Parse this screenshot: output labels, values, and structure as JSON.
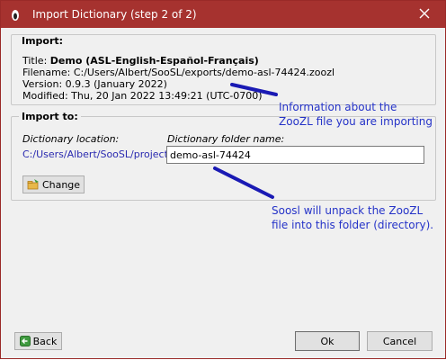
{
  "window": {
    "title": "Import Dictionary (step 2 of 2)"
  },
  "import_group": {
    "heading": "Import:",
    "title_label": "Title:",
    "title_value": "Demo (ASL-English-Español-Français)",
    "filename_label": "Filename:",
    "filename_value": "C:/Users/Albert/SooSL/exports/demo-asl-74424.zoozl",
    "version_label": "Version:",
    "version_value": "0.9.3 (January 2022)",
    "modified_label": "Modified:",
    "modified_value": "Thu, 20 Jan 2022 13:49:21 (UTC-0700)"
  },
  "import_to_group": {
    "heading": "Import to:",
    "location_label": "Dictionary location:",
    "location_value": "C:/Users/Albert/SooSL/projects/",
    "folder_label": "Dictionary folder name:",
    "folder_value": "demo-asl-74424",
    "change_button": "Change",
    "change_icon": "folder-change-icon"
  },
  "annotations": {
    "note1_line1": "Information about the",
    "note1_line2": "ZooZL file you are importing",
    "note2_line1": "Soosl will unpack the ZooZL",
    "note2_line2": "file into this folder (directory).",
    "color": "#2533c8"
  },
  "footer": {
    "back_button": "Back",
    "ok_button": "Ok",
    "cancel_button": "Cancel",
    "back_icon": "back-arrow-icon"
  },
  "colors": {
    "titlebar": "#a6322f",
    "window_bg": "#f0f0f0"
  }
}
